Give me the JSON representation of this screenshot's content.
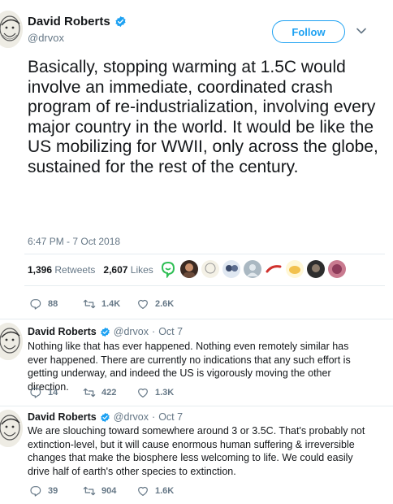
{
  "main_tweet": {
    "name": "David Roberts",
    "handle": "@drvox",
    "follow_label": "Follow",
    "text": "Basically, stopping warming at 1.5C would involve an immediate, coordinated crash program of re-industrialization, involving every major country in the world. It would be like the US mobilizing for WWII, only across the globe, sustained for the rest of the century.",
    "timestamp": "6:47 PM - 7 Oct 2018",
    "retweets_count": "1,396",
    "retweets_label": "Retweets",
    "likes_count": "2,607",
    "likes_label": "Likes",
    "reply_count": "88",
    "retweet_count_short": "1.4K",
    "like_count_short": "2.6K"
  },
  "replies": [
    {
      "name": "David Roberts",
      "handle": "@drvox",
      "dot": "·",
      "date": "Oct 7",
      "text": "Nothing like that has ever happened. Nothing even remotely similar has ever happened. There are currently no indications that any such effort is getting underway, and indeed the US is vigorously moving the other direction.",
      "reply_count": "14",
      "retweet_count": "422",
      "like_count": "1.3K"
    },
    {
      "name": "David Roberts",
      "handle": "@drvox",
      "dot": "·",
      "date": "Oct 7",
      "text": "We are slouching toward somewhere around 3 or 3.5C. That's probably not extinction-level, but it will cause enormous human suffering & irreversible changes that make the biosphere less welcoming to life. We could easily drive half of earth's other species to extinction.",
      "reply_count": "39",
      "retweet_count": "904",
      "like_count": "1.6K"
    }
  ],
  "colors": {
    "brand_blue": "#1da1f2",
    "text_primary": "#14171a",
    "text_secondary": "#657786",
    "divider": "#e6ecf0"
  },
  "icons": [
    "verified-badge-icon",
    "chevron-down-icon",
    "reply-icon",
    "retweet-icon",
    "like-icon"
  ]
}
